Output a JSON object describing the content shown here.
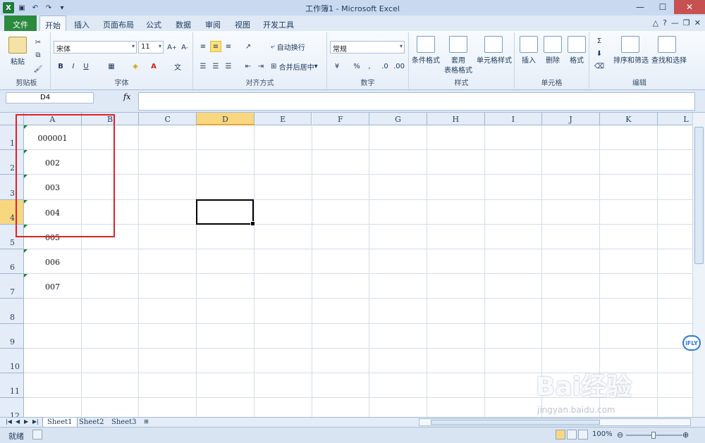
{
  "window": {
    "title": "工作簿1 - Microsoft Excel"
  },
  "tabs": [
    "文件",
    "开始",
    "插入",
    "页面布局",
    "公式",
    "数据",
    "审阅",
    "视图",
    "开发工具"
  ],
  "ribbon": {
    "clipboard": {
      "paste": "粘贴",
      "label": "剪贴板"
    },
    "font": {
      "name": "宋体",
      "size": "11",
      "label": "字体",
      "bold": "B",
      "italic": "I",
      "underline": "U"
    },
    "alignment": {
      "wrap": "自动换行",
      "merge": "合并后居中",
      "label": "对齐方式"
    },
    "number": {
      "format": "常规",
      "percent": "%",
      "comma": ",",
      "label": "数字"
    },
    "styles": {
      "conditional": "条件格式",
      "table_format_line1": "套用",
      "table_format_line2": "表格格式",
      "cell_styles": "单元格样式",
      "label": "样式"
    },
    "cells": {
      "insert": "插入",
      "delete": "删除",
      "format": "格式",
      "label": "单元格"
    },
    "editing": {
      "sort": "排序和筛选",
      "find": "查找和选择",
      "label": "编辑"
    }
  },
  "formula_bar": {
    "name_box": "D4",
    "fx": "fx",
    "content": ""
  },
  "columns": [
    "A",
    "B",
    "C",
    "D",
    "E",
    "F",
    "G",
    "H",
    "I",
    "J",
    "K",
    "L"
  ],
  "rows": [
    "1",
    "2",
    "3",
    "4",
    "5",
    "6",
    "7",
    "8",
    "9",
    "10",
    "11",
    "12"
  ],
  "cells": {
    "A1": "000001",
    "A2": "002",
    "A3": "003",
    "A4": "004",
    "A5": "005",
    "A6": "006",
    "A7": "007"
  },
  "active_cell": "D4",
  "sheets": [
    "Sheet1",
    "Sheet2",
    "Sheet3"
  ],
  "active_sheet": "Sheet1",
  "status": {
    "ready": "就绪",
    "zoom": "100%"
  },
  "badge": "iFLY",
  "watermark": {
    "brand": "Bai经验",
    "url": "jingyan.baidu.com"
  }
}
